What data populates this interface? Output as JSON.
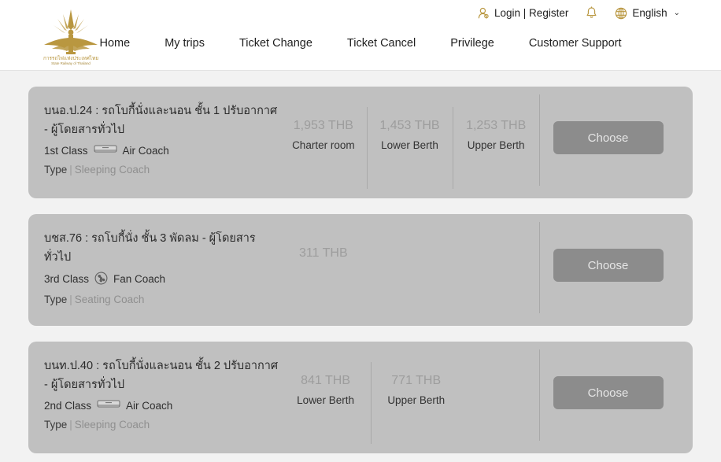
{
  "header": {
    "logo": {
      "name": "state-railway-of-thailand-logo",
      "thai_text": "การรถไฟแห่งประเทศไทย",
      "english_text": "State Railway of Thailand"
    },
    "utility": {
      "account": {
        "label": "Login | Register",
        "icon": "user-icon"
      },
      "notifications": {
        "icon": "bell-icon"
      },
      "language": {
        "label": "English",
        "icon": "globe-icon",
        "caret": "⌄"
      }
    },
    "nav": [
      {
        "label": "Home"
      },
      {
        "label": "My trips"
      },
      {
        "label": "Ticket Change"
      },
      {
        "label": "Ticket Cancel"
      },
      {
        "label": "Privilege"
      },
      {
        "label": "Customer Support"
      }
    ]
  },
  "colors": {
    "brand_gold": "#b99740",
    "card_bg": "#c0c0c0",
    "page_bg": "#f2f2f2",
    "button_bg": "#8c8c8c",
    "price_text": "#9d9d9d"
  },
  "results": {
    "choose_label": "Choose",
    "type_key": "Type",
    "cards": [
      {
        "title": "บนอ.ป.24 : รถโบกี้นั่งและนอน ชั้น 1 ปรับอากาศ - ผู้โดยสารทั่วไป",
        "class": "1st Class",
        "coach_icon": "air-conditioner-icon",
        "coach_type_label": "Air Coach",
        "type_value": "Sleeping Coach",
        "prices": [
          {
            "amount": "1,953 THB",
            "label": "Charter room"
          },
          {
            "amount": "1,453 THB",
            "label": "Lower Berth"
          },
          {
            "amount": "1,253 THB",
            "label": "Upper Berth"
          }
        ]
      },
      {
        "title": "บชส.76 : รถโบกี้นั่ง ชั้น 3 พัดลม - ผู้โดยสารทั่วไป",
        "class": "3rd Class",
        "coach_icon": "fan-icon",
        "coach_type_label": "Fan Coach",
        "type_value": "Seating Coach",
        "prices": [
          {
            "amount": "311 THB",
            "label": ""
          }
        ]
      },
      {
        "title": "บนท.ป.40 : รถโบกี้นั่งและนอน ชั้น 2 ปรับอากาศ - ผู้โดยสารทั่วไป",
        "class": "2nd Class",
        "coach_icon": "air-conditioner-icon",
        "coach_type_label": "Air Coach",
        "type_value": "Sleeping Coach",
        "prices": [
          {
            "amount": "841 THB",
            "label": "Lower Berth"
          },
          {
            "amount": "771 THB",
            "label": "Upper Berth"
          }
        ]
      }
    ]
  }
}
